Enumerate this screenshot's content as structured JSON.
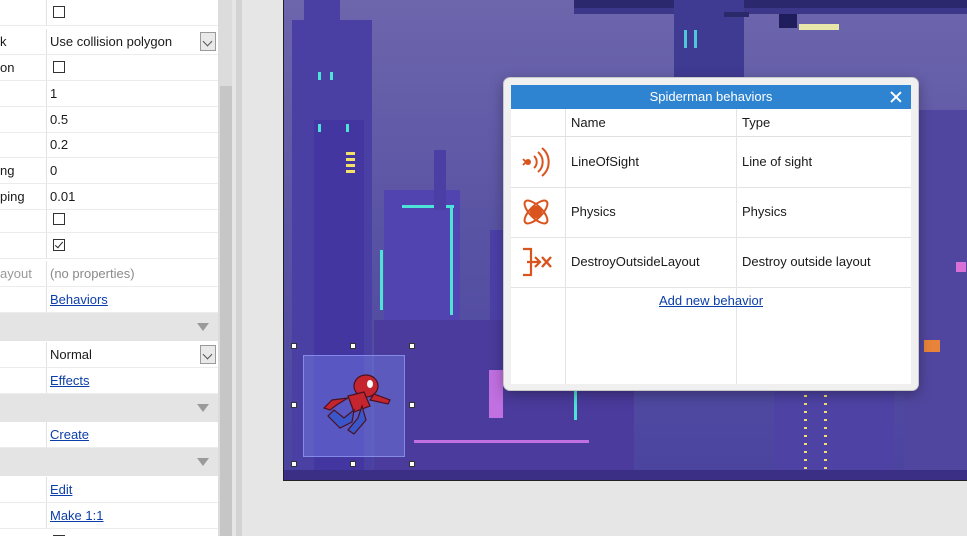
{
  "properties": {
    "rows": [
      {
        "name": "",
        "type": "checkbox",
        "checked": false
      },
      {
        "name": "k",
        "type": "select",
        "value": "Use collision polygon"
      },
      {
        "name": "on",
        "type": "checkbox",
        "checked": false
      },
      {
        "name": "",
        "type": "text",
        "value": "1"
      },
      {
        "name": "",
        "type": "text",
        "value": "0.5"
      },
      {
        "name": "",
        "type": "text",
        "value": "0.2"
      },
      {
        "name": "ng",
        "type": "text",
        "value": "0"
      },
      {
        "name": "ping",
        "type": "text",
        "value": "0.01"
      },
      {
        "name": "",
        "type": "checkbox",
        "checked": false
      },
      {
        "name": "",
        "type": "checkbox",
        "checked": true
      },
      {
        "name": "ayout",
        "type": "muted",
        "value": "(no properties)"
      },
      {
        "name": "",
        "type": "link",
        "value": "Behaviors"
      },
      {
        "name": "",
        "type": "select",
        "value": "Normal"
      },
      {
        "name": "",
        "type": "link",
        "value": "Effects"
      },
      {
        "name": "",
        "type": "link",
        "value": "Create"
      },
      {
        "name": "",
        "type": "link",
        "value": "Edit"
      },
      {
        "name": "",
        "type": "link",
        "value": "Make 1:1"
      }
    ]
  },
  "dialog": {
    "title": "Spiderman behaviors",
    "columns": {
      "name": "Name",
      "type": "Type"
    },
    "behaviors": [
      {
        "name": "LineOfSight",
        "type": "Line of sight",
        "icon": "line-of-sight-icon"
      },
      {
        "name": "Physics",
        "type": "Physics",
        "icon": "physics-icon"
      },
      {
        "name": "DestroyOutsideLayout",
        "type": "Destroy outside layout",
        "icon": "destroy-outside-layout-icon"
      }
    ],
    "add_label": "Add new behavior"
  },
  "colors": {
    "accent": "#2f84d2",
    "icon": "#d9541e",
    "link": "#0b3ea8"
  }
}
